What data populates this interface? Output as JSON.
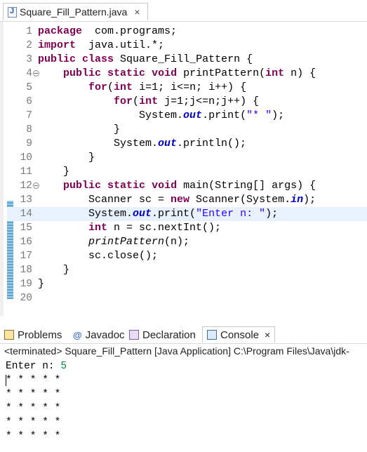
{
  "editor": {
    "tab_title": "Square_Fill_Pattern.java",
    "tab_close": "×",
    "lines": [
      {
        "n": "1",
        "segs": [
          [
            "kw",
            "package"
          ],
          [
            "",
            "  com.programs;"
          ]
        ]
      },
      {
        "n": "2",
        "segs": [
          [
            "kw",
            "import"
          ],
          [
            "",
            "  java.util.*;"
          ]
        ]
      },
      {
        "n": "3",
        "segs": [
          [
            "kw",
            "public"
          ],
          [
            "",
            " "
          ],
          [
            "kw",
            "class"
          ],
          [
            "",
            " Square_Fill_Pattern {"
          ]
        ]
      },
      {
        "n": "4",
        "fold": true,
        "segs": [
          [
            "",
            "    "
          ],
          [
            "kw",
            "public"
          ],
          [
            "",
            " "
          ],
          [
            "kw",
            "static"
          ],
          [
            "",
            " "
          ],
          [
            "kw",
            "void"
          ],
          [
            "",
            " printPattern("
          ],
          [
            "kw",
            "int"
          ],
          [
            "",
            " n) {"
          ]
        ]
      },
      {
        "n": "5",
        "segs": [
          [
            "",
            "        "
          ],
          [
            "kw",
            "for"
          ],
          [
            "",
            "("
          ],
          [
            "kw",
            "int"
          ],
          [
            "",
            " i=1; i<=n; i++) {"
          ]
        ]
      },
      {
        "n": "6",
        "segs": [
          [
            "",
            "            "
          ],
          [
            "kw",
            "for"
          ],
          [
            "",
            "("
          ],
          [
            "kw",
            "int"
          ],
          [
            "",
            " j=1;j<=n;j++) {"
          ]
        ]
      },
      {
        "n": "7",
        "segs": [
          [
            "",
            "                System."
          ],
          [
            "fld",
            "out"
          ],
          [
            "",
            ".print("
          ],
          [
            "str",
            "\"* \""
          ],
          [
            "",
            ");"
          ]
        ]
      },
      {
        "n": "8",
        "segs": [
          [
            "",
            "            }"
          ]
        ]
      },
      {
        "n": "9",
        "segs": [
          [
            "",
            "            System."
          ],
          [
            "fld",
            "out"
          ],
          [
            "",
            ".println();"
          ]
        ]
      },
      {
        "n": "10",
        "segs": [
          [
            "",
            "        }"
          ]
        ]
      },
      {
        "n": "11",
        "segs": [
          [
            "",
            "    }"
          ]
        ]
      },
      {
        "n": "12",
        "fold": true,
        "segs": [
          [
            "",
            "    "
          ],
          [
            "kw",
            "public"
          ],
          [
            "",
            " "
          ],
          [
            "kw",
            "static"
          ],
          [
            "",
            " "
          ],
          [
            "kw",
            "void"
          ],
          [
            "",
            " main(String[] args) {"
          ]
        ]
      },
      {
        "n": "13",
        "segs": [
          [
            "",
            "        Scanner sc = "
          ],
          [
            "kw",
            "new"
          ],
          [
            "",
            " Scanner(System."
          ],
          [
            "fld",
            "in"
          ],
          [
            "",
            ");"
          ]
        ]
      },
      {
        "n": "14",
        "current": true,
        "segs": [
          [
            "",
            "        System."
          ],
          [
            "fld",
            "out"
          ],
          [
            "",
            ".print("
          ],
          [
            "str",
            "\"Enter n: \""
          ],
          [
            "",
            ");"
          ]
        ]
      },
      {
        "n": "15",
        "segs": [
          [
            "",
            "        "
          ],
          [
            "kw",
            "int"
          ],
          [
            "",
            " n = sc.nextInt();"
          ]
        ]
      },
      {
        "n": "16",
        "segs": [
          [
            "",
            "        "
          ],
          [
            "ital",
            "printPattern"
          ],
          [
            "",
            "(n);"
          ]
        ]
      },
      {
        "n": "17",
        "segs": [
          [
            "",
            "        sc.close();"
          ]
        ]
      },
      {
        "n": "18",
        "segs": [
          [
            "",
            "    }"
          ]
        ]
      },
      {
        "n": "19",
        "segs": [
          [
            "",
            "}"
          ]
        ]
      },
      {
        "n": "20",
        "segs": [
          [
            "",
            ""
          ]
        ]
      }
    ]
  },
  "panel": {
    "tabs": [
      {
        "id": "problems",
        "label": "Problems",
        "icon": "problems-icon"
      },
      {
        "id": "javadoc",
        "label": "Javadoc",
        "icon": "javadoc-icon",
        "glyph": "@"
      },
      {
        "id": "declaration",
        "label": "Declaration",
        "icon": "declaration-icon"
      },
      {
        "id": "console",
        "label": "Console",
        "icon": "console-icon",
        "active": true
      }
    ],
    "console_close": "×",
    "status": "<terminated> Square_Fill_Pattern [Java Application] C:\\Program Files\\Java\\jdk-",
    "prompt": "Enter n: ",
    "input": "5",
    "output_rows": [
      "* * * * *",
      "* * * * *",
      "* * * * *",
      "* * * * *",
      "* * * * *"
    ]
  }
}
